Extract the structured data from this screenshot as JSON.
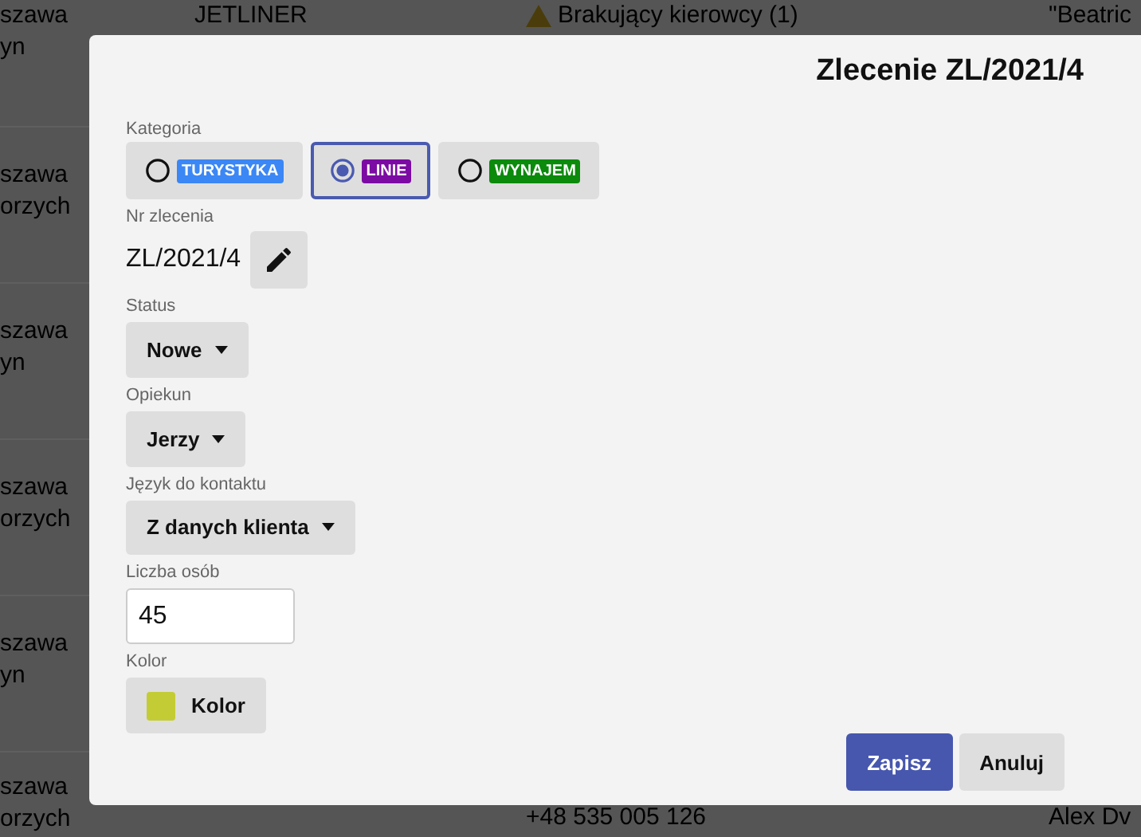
{
  "background_table": {
    "rows": [
      {
        "column_1": [
          "szawa",
          "yn"
        ],
        "column_2": "JETLINER",
        "column_3": {
          "text": "Brakujący kierowcy (1)",
          "warning": true
        },
        "column_4": "\"Beatric"
      },
      {
        "column_1": [
          "szawa",
          "orzych"
        ]
      },
      {
        "column_1": [
          "szawa",
          "yn"
        ]
      },
      {
        "column_1": [
          "szawa",
          "orzych"
        ]
      },
      {
        "column_1": [
          "szawa",
          "yn"
        ]
      },
      {
        "column_1": [
          "szawa",
          "orzych"
        ],
        "column_3": {
          "text": "+48 535 005 126"
        },
        "column_4": "Alex Dv"
      }
    ]
  },
  "dialog": {
    "title": "Zlecenie ZL/2021/4",
    "category": {
      "label": "Kategoria",
      "options": [
        {
          "label": "TURYSTYKA",
          "color": "#3b87f5",
          "selected": false
        },
        {
          "label": "LINIE",
          "color": "#7b0ba3",
          "selected": true
        },
        {
          "label": "WYNAJEM",
          "color": "#0b8a0b",
          "selected": false
        }
      ]
    },
    "order_number": {
      "label": "Nr zlecenia",
      "value": "ZL/2021/4"
    },
    "status": {
      "label": "Status",
      "value": "Nowe"
    },
    "guardian": {
      "label": "Opiekun",
      "value": "Jerzy"
    },
    "language": {
      "label": "Język do kontaktu",
      "value": "Z danych klienta"
    },
    "people": {
      "label": "Liczba osób",
      "value": "45"
    },
    "color": {
      "label": "Kolor",
      "button": "Kolor",
      "color": "#c4cc35"
    },
    "buttons": {
      "save": "Zapisz",
      "cancel": "Anuluj"
    }
  }
}
